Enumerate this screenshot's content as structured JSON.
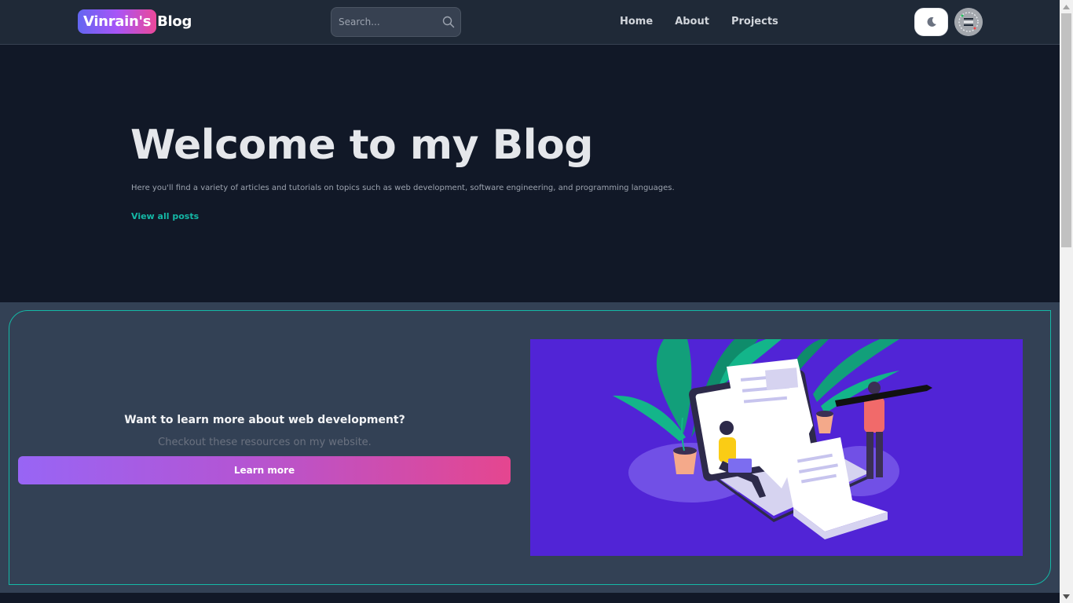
{
  "header": {
    "brand_highlight": "Vinrain's",
    "brand_suffix": "Blog",
    "search_placeholder": "Search...",
    "search_icon": "search-icon",
    "nav": [
      {
        "label": "Home"
      },
      {
        "label": "About"
      },
      {
        "label": "Projects"
      }
    ],
    "theme_toggle_icon": "moon-icon",
    "avatar_icon": "avatar"
  },
  "hero": {
    "title": "Welcome to my Blog",
    "description": "Here you'll find a variety of articles and tutorials on topics such as web development, software engineering, and programming languages.",
    "link_label": "View all posts"
  },
  "promo": {
    "question": "Want to learn more about web development?",
    "subtitle": "Checkout these resources on my website.",
    "button_label": "Learn more",
    "illustration": "web-development-illustration"
  },
  "colors": {
    "page_bg": "#111827",
    "header_bg": "#1f2937",
    "accent_teal": "#14b8a6",
    "promo_bg": "#334155",
    "illustration_bg": "#5124d6",
    "gradient_start": "#9865f5",
    "gradient_end": "#e5468f"
  }
}
